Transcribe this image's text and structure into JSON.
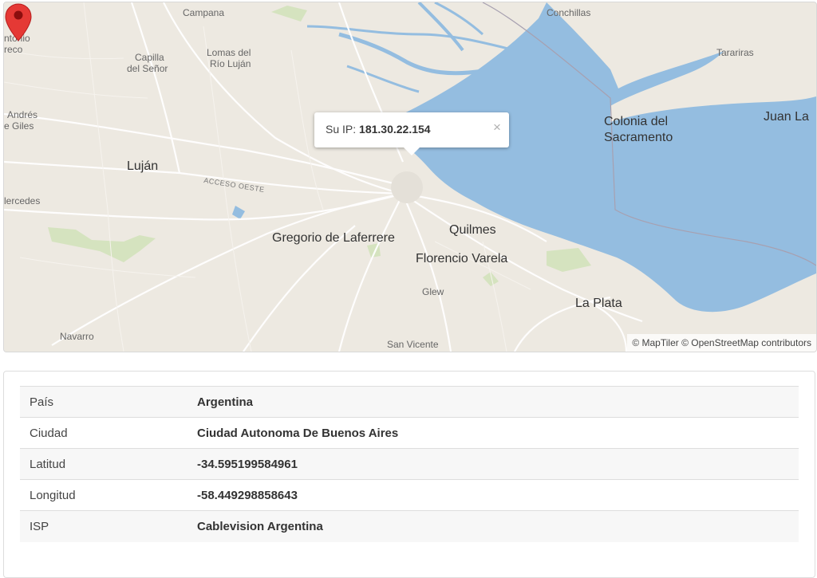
{
  "map": {
    "attribution": "© MapTiler © OpenStreetMap contributors",
    "popup": {
      "label": "Su IP:",
      "ip": "181.30.22.154",
      "close_symbol": "×"
    },
    "labels": {
      "campana": "Campana",
      "conchillas": "Conchillas",
      "antonio": "ntonio",
      "areco": "reco",
      "capilla": "Capilla",
      "del_senor": "del Señor",
      "lomas": "Lomas del",
      "rio_lujan": "Río Luján",
      "tarariras": "Tarariras",
      "andres": "Andrés",
      "giles": "e Giles",
      "colonia_del": "Colonia del",
      "sacramento": "Sacramento",
      "juan_la": "Juan La",
      "lujan": "Luján",
      "acceso_oeste": "ACCESO OESTE",
      "mercedes": "lercedes",
      "gregorio": "Gregorio de Laferrere",
      "quilmes": "Quilmes",
      "florencio": "Florencio Varela",
      "glew": "Glew",
      "la_plata": "La Plata",
      "navarro": "Navarro",
      "san_vicente": "San Vicente"
    },
    "colors": {
      "water": "#94bde0",
      "land": "#ede9e1",
      "green": "#cfe0b4",
      "marker": "#e53935"
    }
  },
  "info": {
    "rows": [
      {
        "key": "País",
        "value": "Argentina"
      },
      {
        "key": "Ciudad",
        "value": "Ciudad Autonoma De Buenos Aires"
      },
      {
        "key": "Latitud",
        "value": "-34.595199584961"
      },
      {
        "key": "Longitud",
        "value": "-58.449298858643"
      },
      {
        "key": "ISP",
        "value": "Cablevision Argentina"
      }
    ]
  }
}
